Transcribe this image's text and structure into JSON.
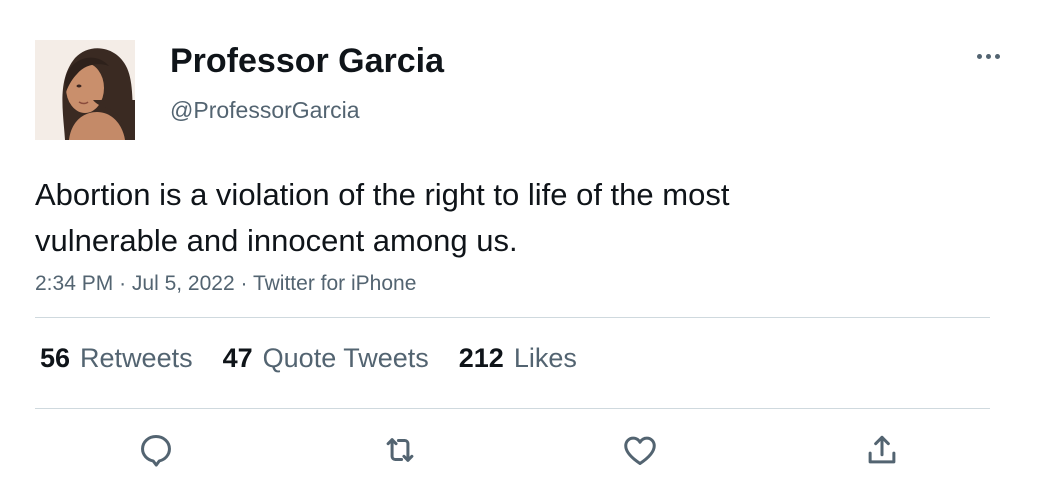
{
  "author": {
    "display_name": "Professor Garcia",
    "handle": "@ProfessorGarcia",
    "avatar_icon": "profile-photo"
  },
  "tweet": {
    "text": "Abortion is a violation of the right to life of the most vulnerable and innocent among us.",
    "time": "2:34 PM",
    "date": "Jul 5, 2022",
    "source": "Twitter for iPhone",
    "separator": "·"
  },
  "stats": {
    "retweets": {
      "count": "56",
      "label": "Retweets"
    },
    "quotes": {
      "count": "47",
      "label": "Quote Tweets"
    },
    "likes": {
      "count": "212",
      "label": "Likes"
    }
  },
  "actions": {
    "reply_icon": "speech-bubble",
    "retweet_icon": "retweet-arrows",
    "like_icon": "heart",
    "share_icon": "share-upload"
  },
  "colors": {
    "text_primary": "#0f1419",
    "text_secondary": "#536471",
    "divider": "#cfd9de"
  }
}
